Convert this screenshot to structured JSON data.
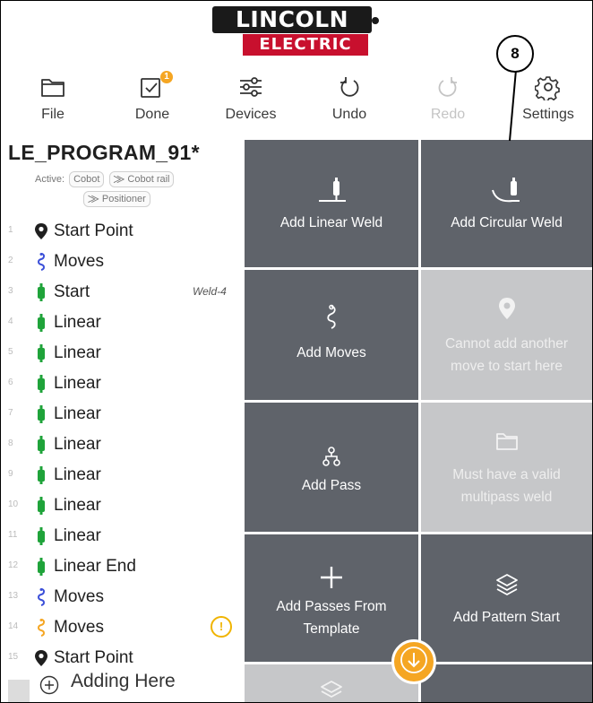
{
  "logo": {
    "top": "LINCOLN",
    "bottom": "ELECTRIC"
  },
  "callout": {
    "number": "8"
  },
  "toolbar": {
    "items": [
      {
        "label": "File",
        "icon": "folder-icon",
        "enabled": true
      },
      {
        "label": "Done",
        "icon": "checkbox-icon",
        "enabled": true,
        "badge": "1"
      },
      {
        "label": "Devices",
        "icon": "sliders-icon",
        "enabled": true
      },
      {
        "label": "Undo",
        "icon": "undo-icon",
        "enabled": true
      },
      {
        "label": "Redo",
        "icon": "redo-icon",
        "enabled": false
      },
      {
        "label": "Settings",
        "icon": "gear-icon",
        "enabled": true
      }
    ]
  },
  "program": {
    "name": "LE_PROGRAM_91*",
    "active_label": "Active:",
    "chips": [
      "Cobot",
      "Cobot rail",
      "Positioner"
    ]
  },
  "steps": [
    {
      "num": "1",
      "icon": "location-pin-icon",
      "label": "Start Point"
    },
    {
      "num": "2",
      "icon": "moves-icon",
      "label": "Moves"
    },
    {
      "num": "3",
      "icon": "torch-icon",
      "label": "Start",
      "extra": "Weld-4"
    },
    {
      "num": "4",
      "icon": "torch-icon",
      "label": "Linear"
    },
    {
      "num": "5",
      "icon": "torch-icon",
      "label": "Linear"
    },
    {
      "num": "6",
      "icon": "torch-icon",
      "label": "Linear"
    },
    {
      "num": "7",
      "icon": "torch-icon",
      "label": "Linear"
    },
    {
      "num": "8",
      "icon": "torch-icon",
      "label": "Linear"
    },
    {
      "num": "9",
      "icon": "torch-icon",
      "label": "Linear"
    },
    {
      "num": "10",
      "icon": "torch-icon",
      "label": "Linear"
    },
    {
      "num": "11",
      "icon": "torch-icon",
      "label": "Linear"
    },
    {
      "num": "12",
      "icon": "torch-icon",
      "label": "Linear End"
    },
    {
      "num": "13",
      "icon": "moves-icon",
      "label": "Moves"
    },
    {
      "num": "14",
      "icon": "moves-warning-icon",
      "label": "Moves",
      "warning": "!"
    },
    {
      "num": "15",
      "icon": "location-pin-icon",
      "label": "Start Point"
    }
  ],
  "adding": {
    "label": "Adding Here"
  },
  "tiles": {
    "add_linear_weld": "Add Linear Weld",
    "add_circular_weld": "Add Circular Weld",
    "add_moves": "Add Moves",
    "cannot_add_move": "Cannot add another move to start here",
    "add_pass": "Add Pass",
    "must_have_multipass": "Must have a valid multipass weld",
    "add_passes_template": "Add Passes From Template",
    "add_pattern_start": "Add Pattern Start"
  },
  "colors": {
    "tile": "#5f636a",
    "tile_disabled": "#c6c7c9",
    "accent": "#f5a623",
    "torch": "#1fa33a",
    "moves": "#3b4fd8",
    "brand_red": "#c8102e"
  }
}
